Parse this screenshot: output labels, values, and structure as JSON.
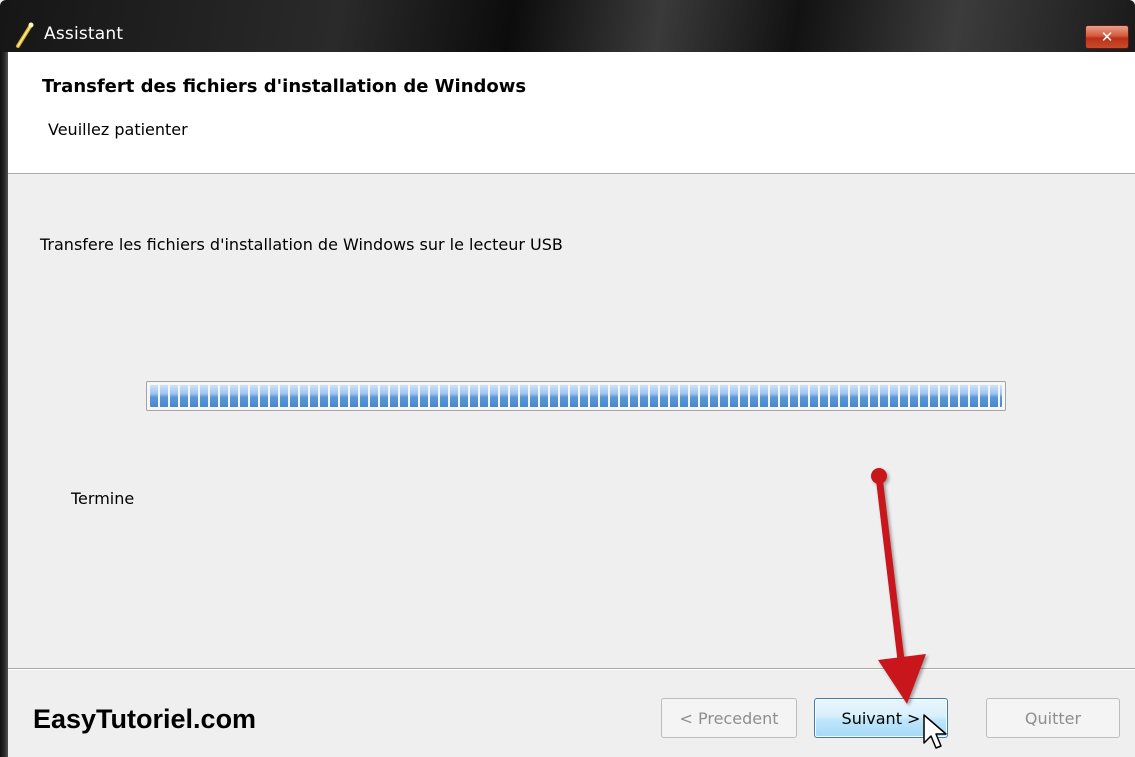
{
  "window": {
    "title": "Assistant",
    "close_glyph": "✕"
  },
  "header": {
    "title": "Transfert des fichiers d'installation de Windows",
    "subtitle": "Veuillez patienter"
  },
  "content": {
    "description": "Transfere les fichiers d'installation de Windows sur le lecteur USB",
    "progress_percent": 100,
    "status": "Termine"
  },
  "footer": {
    "watermark": "EasyTutoriel.com",
    "buttons": {
      "previous": "< Precedent",
      "next": "Suivant >",
      "quit": "Quitter"
    }
  },
  "icons": {
    "app": "wand-icon",
    "close": "close-icon",
    "annotation": "red-arrow-annotation",
    "cursor": "mouse-pointer-icon"
  },
  "colors": {
    "annotation_arrow": "#c8191a",
    "progress_fill": "#5b98d8",
    "next_button_border": "#3c7fb1"
  }
}
